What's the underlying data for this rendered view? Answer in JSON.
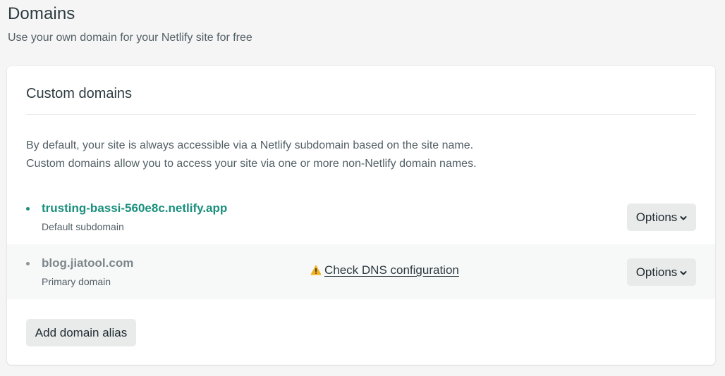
{
  "header": {
    "title": "Domains",
    "subtitle": "Use your own domain for your Netlify site for free"
  },
  "custom_domains": {
    "title": "Custom domains",
    "description": [
      "By default, your site is always accessible via a Netlify subdomain based on the site name.",
      "Custom domains allow you to access your site via one or more non-Netlify domain names."
    ],
    "domains": [
      {
        "name": "trusting-bassi-560e8c.netlify.app",
        "label": "Default subdomain",
        "options_label": "Options"
      },
      {
        "name": "blog.jiatool.com",
        "label": "Primary domain",
        "warning_label": "Check DNS configuration",
        "options_label": "Options"
      }
    ],
    "add_alias_label": "Add domain alias"
  },
  "colors": {
    "accent_teal": "#1a8f7c",
    "warning_yellow": "#f2b01e",
    "button_bg": "#e9ebeb"
  },
  "icons": {
    "warning": "warning-triangle-icon",
    "chevron": "chevron-down-icon"
  }
}
